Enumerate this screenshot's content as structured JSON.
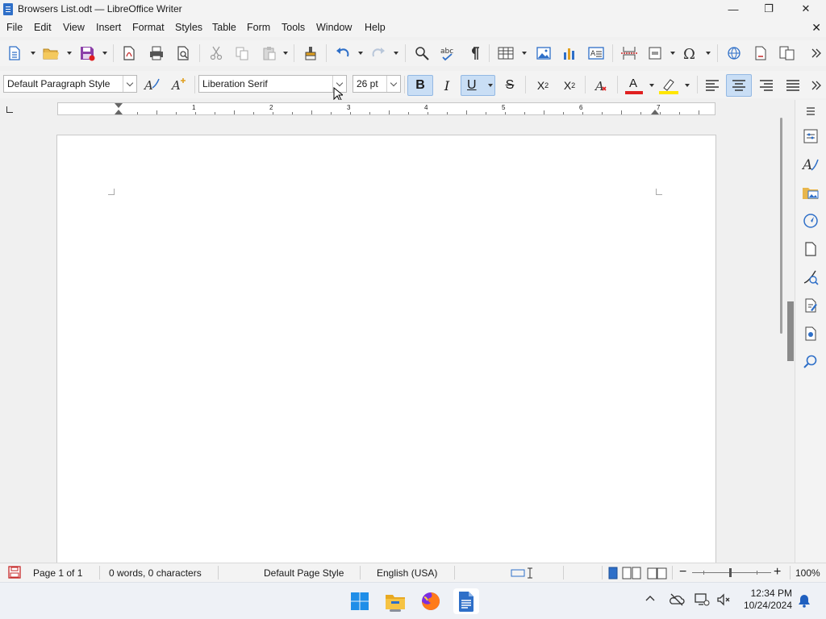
{
  "window": {
    "title": "Browsers List.odt — LibreOffice Writer",
    "minimize": "—",
    "maximize": "❐",
    "close": "✕"
  },
  "menu": [
    "File",
    "Edit",
    "View",
    "Insert",
    "Format",
    "Styles",
    "Table",
    "Form",
    "Tools",
    "Window",
    "Help"
  ],
  "close_document": "✕",
  "formatting": {
    "paragraph_style": "Default Paragraph Style",
    "font_name": "Liberation Serif",
    "font_size": "26 pt",
    "bold": "B",
    "italic": "I",
    "underline": "U",
    "strikethrough": "S",
    "superscript": "X",
    "superscript_mark": "2",
    "subscript": "X",
    "subscript_mark": "2",
    "font_color_letter": "A",
    "underline_active": true,
    "align_center_active": true
  },
  "ruler": {
    "numbers": [
      "1",
      "2",
      "3",
      "4",
      "5",
      "6",
      "7"
    ]
  },
  "status": {
    "page": "Page 1 of 1",
    "words": "0 words, 0 characters",
    "page_style": "Default Page Style",
    "language": "English (USA)",
    "zoom": "100%",
    "zoom_minus": "−",
    "zoom_plus": "+"
  },
  "taskbar": {
    "time": "12:34 PM",
    "date": "10/24/2024"
  },
  "colors": {
    "accent_blue": "#2e6fc8",
    "font_color_red": "#e02020",
    "highlight_yellow": "#ffe600",
    "active_button": "#c9def5"
  }
}
